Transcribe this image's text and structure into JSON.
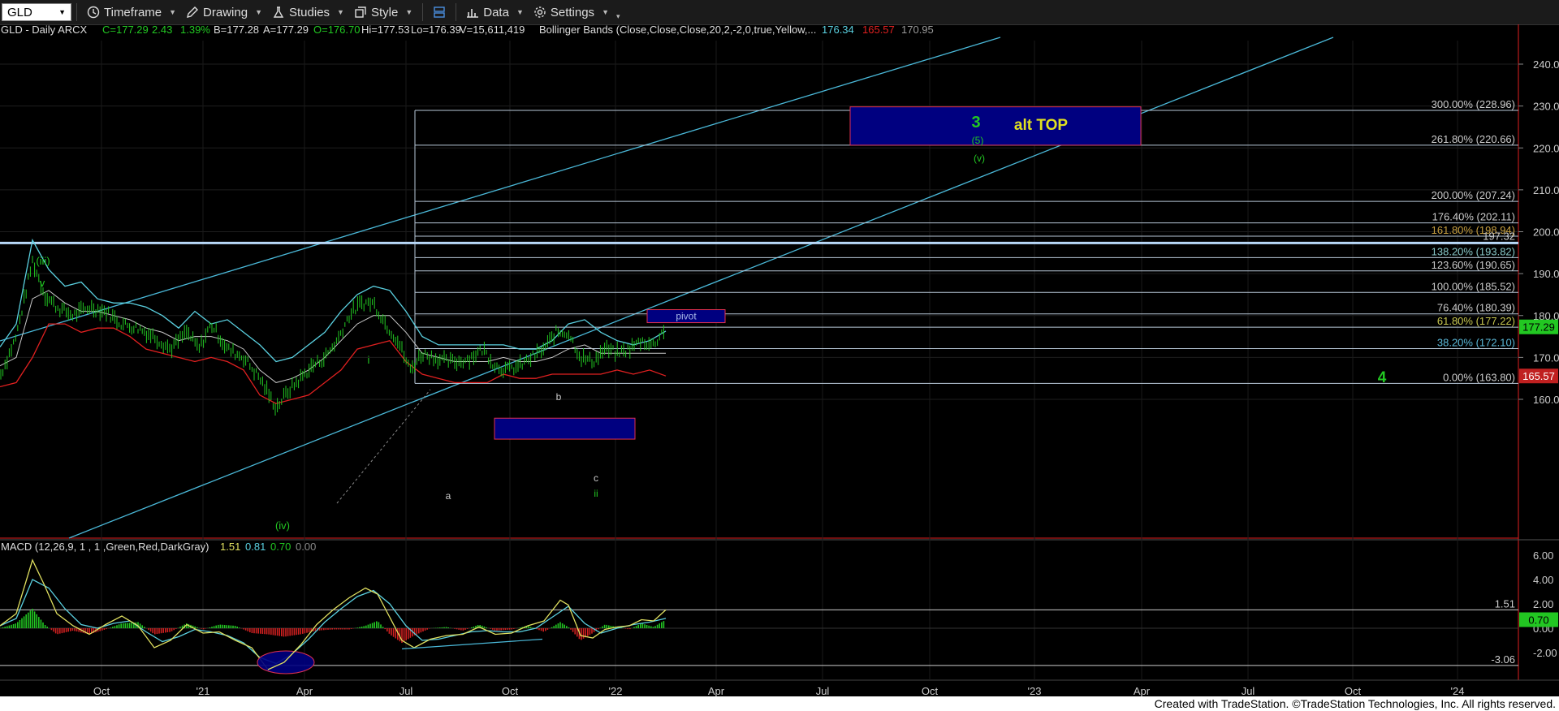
{
  "toolbar": {
    "symbol": "GLD",
    "timeframe": "Timeframe",
    "drawing": "Drawing",
    "studies": "Studies",
    "style": "Style",
    "data": "Data",
    "settings": "Settings"
  },
  "header": {
    "symbol": "GLD - Daily  ARCX",
    "close": "C=177.29",
    "change": "2.43",
    "change_pct": "1.39%",
    "bid": "B=177.28",
    "ask": "A=177.29",
    "open": "O=176.70",
    "high": "Hi=177.53",
    "low": "Lo=176.39",
    "volume": "V=15,611,419",
    "study": "Bollinger Bands (Close,Close,Close,20,2,-2,0,true,Yellow,...",
    "bb_upper": "176.34",
    "bb_lower": "165.57",
    "bb_mid": "170.95"
  },
  "macd_header": {
    "study": "MACD (12,26,9, 1 , 1 ,Green,Red,DarkGray)",
    "macd": "1.51",
    "signal": "0.81",
    "hist": "0.70",
    "zero": "0.00"
  },
  "footer": "Created with TradeStation. ©TradeStation Technologies, Inc. All rights reserved.",
  "colors": {
    "bb_upper": "#5ad0e0",
    "bb_lower": "#e02020",
    "bb_mid": "#c8c8c8",
    "price": "#22c722",
    "fib": "#b8c8d8",
    "channel": "#4ab8d8",
    "box": "#000080",
    "box_border": "#e03050"
  },
  "chart_data": {
    "type": "candlestick-with-indicators",
    "title": "GLD - Daily ARCX",
    "x_tick_labels": [
      "Oct",
      "'21",
      "Apr",
      "Jul",
      "Oct",
      "'22",
      "Apr",
      "Jul",
      "Oct",
      "'23",
      "Apr",
      "Jul",
      "Oct",
      "'24"
    ],
    "price_axis": {
      "range": [
        152,
        248
      ],
      "ticks": [
        160,
        170,
        180,
        190,
        200,
        210,
        220,
        230,
        240
      ]
    },
    "fib_levels": [
      {
        "label": "300.00% (228.96)",
        "value": 228.96
      },
      {
        "label": "261.80% (220.66)",
        "value": 220.66
      },
      {
        "label": "200.00% (207.24)",
        "value": 207.24
      },
      {
        "label": "176.40% (202.11)",
        "value": 202.11
      },
      {
        "label": "161.80% (198.94)",
        "value": 198.94
      },
      {
        "label": "138.20% (193.82)",
        "value": 193.82
      },
      {
        "label": "123.60% (190.65)",
        "value": 190.65
      },
      {
        "label": "100.00% (185.52)",
        "value": 185.52
      },
      {
        "label": "76.40% (180.39)",
        "value": 180.39
      },
      {
        "label": "61.80% (177.22)",
        "value": 177.22
      },
      {
        "label": "38.20% (172.10)",
        "value": 172.1
      },
      {
        "label": "0.00% (163.80)",
        "value": 163.8
      }
    ],
    "horizontal_line": {
      "label": "197.32",
      "value": 197.32
    },
    "price_tags": [
      {
        "label": "177.29",
        "value": 177.29
      },
      {
        "label": "165.57",
        "value": 165.57
      }
    ],
    "annotations": [
      "(iii)",
      "v",
      "(iv)",
      "i",
      "a",
      "b",
      "c",
      "ii",
      "3",
      "alt TOP",
      "(5)",
      "(v)",
      "4",
      "pivot"
    ],
    "macd_axis": {
      "range": [
        -4,
        7.5
      ],
      "ticks": [
        "6.00",
        "4.00",
        "2.00",
        "0.00",
        "-2.00"
      ]
    },
    "macd_levels": [
      {
        "label": "1.51",
        "value": 1.51
      },
      {
        "label": "-3.06",
        "value": -3.06
      }
    ],
    "macd_tag": "0.70",
    "price": [
      [
        0,
        165.5
      ],
      [
        20,
        175
      ],
      [
        40,
        193
      ],
      [
        55,
        185
      ],
      [
        70,
        182
      ],
      [
        90,
        180
      ],
      [
        110,
        182
      ],
      [
        130,
        181
      ],
      [
        150,
        178
      ],
      [
        170,
        177
      ],
      [
        190,
        175
      ],
      [
        210,
        172
      ],
      [
        230,
        176
      ],
      [
        245,
        172
      ],
      [
        260,
        178
      ],
      [
        280,
        172
      ],
      [
        300,
        170
      ],
      [
        320,
        165
      ],
      [
        340,
        158
      ],
      [
        355,
        162
      ],
      [
        370,
        165
      ],
      [
        385,
        168
      ],
      [
        400,
        170
      ],
      [
        415,
        174
      ],
      [
        430,
        180
      ],
      [
        445,
        183
      ],
      [
        460,
        183
      ],
      [
        475,
        178
      ],
      [
        490,
        174
      ],
      [
        505,
        167
      ],
      [
        520,
        171
      ],
      [
        535,
        170
      ],
      [
        550,
        169
      ],
      [
        565,
        169
      ],
      [
        580,
        170
      ],
      [
        595,
        172
      ],
      [
        610,
        168
      ],
      [
        625,
        167
      ],
      [
        640,
        168
      ],
      [
        655,
        170
      ],
      [
        670,
        172
      ],
      [
        685,
        176
      ],
      [
        700,
        176
      ],
      [
        715,
        170
      ],
      [
        730,
        169
      ],
      [
        745,
        172
      ],
      [
        760,
        171
      ],
      [
        775,
        172
      ],
      [
        790,
        174
      ],
      [
        805,
        173
      ],
      [
        815,
        176
      ],
      [
        820,
        177.3
      ]
    ],
    "bb_upper": [
      [
        0,
        172.5
      ],
      [
        20,
        178
      ],
      [
        40,
        198
      ],
      [
        60,
        191
      ],
      [
        80,
        187
      ],
      [
        100,
        188
      ],
      [
        120,
        184
      ],
      [
        140,
        183
      ],
      [
        160,
        183
      ],
      [
        180,
        182
      ],
      [
        200,
        180
      ],
      [
        220,
        177
      ],
      [
        240,
        181
      ],
      [
        260,
        178
      ],
      [
        280,
        179
      ],
      [
        300,
        176
      ],
      [
        320,
        173
      ],
      [
        340,
        169
      ],
      [
        360,
        170
      ],
      [
        380,
        173
      ],
      [
        400,
        176
      ],
      [
        420,
        181
      ],
      [
        440,
        185
      ],
      [
        460,
        187
      ],
      [
        480,
        186
      ],
      [
        500,
        181
      ],
      [
        520,
        175
      ],
      [
        540,
        173
      ],
      [
        560,
        173
      ],
      [
        580,
        173
      ],
      [
        600,
        173
      ],
      [
        620,
        173
      ],
      [
        640,
        172
      ],
      [
        660,
        172
      ],
      [
        680,
        174
      ],
      [
        700,
        178
      ],
      [
        720,
        179
      ],
      [
        740,
        176
      ],
      [
        760,
        174
      ],
      [
        780,
        173
      ],
      [
        800,
        174
      ],
      [
        820,
        176.3
      ]
    ],
    "bb_mid": [
      [
        0,
        168
      ],
      [
        20,
        170
      ],
      [
        40,
        184
      ],
      [
        60,
        186
      ],
      [
        80,
        183
      ],
      [
        100,
        181
      ],
      [
        120,
        181
      ],
      [
        140,
        180
      ],
      [
        160,
        179
      ],
      [
        180,
        177
      ],
      [
        200,
        176
      ],
      [
        220,
        174
      ],
      [
        240,
        175
      ],
      [
        260,
        175
      ],
      [
        280,
        174
      ],
      [
        300,
        172
      ],
      [
        320,
        167
      ],
      [
        340,
        164
      ],
      [
        360,
        165
      ],
      [
        380,
        167
      ],
      [
        400,
        170
      ],
      [
        420,
        174
      ],
      [
        440,
        178
      ],
      [
        460,
        180
      ],
      [
        480,
        180
      ],
      [
        500,
        176
      ],
      [
        520,
        171
      ],
      [
        540,
        170
      ],
      [
        560,
        169
      ],
      [
        580,
        169
      ],
      [
        600,
        169
      ],
      [
        620,
        170
      ],
      [
        640,
        169
      ],
      [
        660,
        169
      ],
      [
        680,
        170
      ],
      [
        700,
        172
      ],
      [
        720,
        173
      ],
      [
        740,
        171
      ],
      [
        760,
        171
      ],
      [
        780,
        171
      ],
      [
        800,
        171
      ],
      [
        820,
        171
      ]
    ],
    "bb_lower": [
      [
        0,
        163
      ],
      [
        20,
        164
      ],
      [
        40,
        170
      ],
      [
        60,
        178
      ],
      [
        80,
        178
      ],
      [
        100,
        176
      ],
      [
        120,
        177
      ],
      [
        140,
        177
      ],
      [
        160,
        175
      ],
      [
        180,
        172
      ],
      [
        200,
        171
      ],
      [
        220,
        170
      ],
      [
        240,
        169
      ],
      [
        260,
        170
      ],
      [
        280,
        169
      ],
      [
        300,
        167
      ],
      [
        320,
        161
      ],
      [
        340,
        159
      ],
      [
        360,
        160
      ],
      [
        380,
        161
      ],
      [
        400,
        164
      ],
      [
        420,
        167
      ],
      [
        440,
        172
      ],
      [
        460,
        173
      ],
      [
        480,
        174
      ],
      [
        500,
        169
      ],
      [
        520,
        166
      ],
      [
        540,
        165
      ],
      [
        560,
        164
      ],
      [
        580,
        164
      ],
      [
        600,
        164
      ],
      [
        620,
        166
      ],
      [
        640,
        165
      ],
      [
        660,
        165
      ],
      [
        680,
        166
      ],
      [
        700,
        166
      ],
      [
        720,
        166
      ],
      [
        740,
        166
      ],
      [
        760,
        167
      ],
      [
        780,
        166
      ],
      [
        800,
        167
      ],
      [
        820,
        165.57
      ]
    ],
    "macd_line": [
      [
        0,
        0.2
      ],
      [
        20,
        1.2
      ],
      [
        40,
        5.6
      ],
      [
        55,
        3.5
      ],
      [
        70,
        1.2
      ],
      [
        90,
        0.2
      ],
      [
        110,
        -0.5
      ],
      [
        130,
        0.3
      ],
      [
        150,
        1.0
      ],
      [
        170,
        0.2
      ],
      [
        190,
        -1.6
      ],
      [
        210,
        -1.0
      ],
      [
        230,
        0.3
      ],
      [
        250,
        -0.4
      ],
      [
        270,
        -0.3
      ],
      [
        290,
        -1.0
      ],
      [
        310,
        -1.6
      ],
      [
        330,
        -3.4
      ],
      [
        350,
        -2.8
      ],
      [
        370,
        -1.4
      ],
      [
        390,
        0.3
      ],
      [
        410,
        1.5
      ],
      [
        430,
        2.5
      ],
      [
        450,
        3.3
      ],
      [
        465,
        2.8
      ],
      [
        480,
        0.9
      ],
      [
        495,
        -1.0
      ],
      [
        510,
        -1.6
      ],
      [
        530,
        -0.9
      ],
      [
        550,
        -0.6
      ],
      [
        570,
        -0.5
      ],
      [
        590,
        0.1
      ],
      [
        610,
        -0.5
      ],
      [
        630,
        -0.4
      ],
      [
        650,
        0.2
      ],
      [
        670,
        0.6
      ],
      [
        690,
        2.3
      ],
      [
        700,
        1.9
      ],
      [
        715,
        -0.6
      ],
      [
        730,
        -0.8
      ],
      [
        745,
        -0.1
      ],
      [
        760,
        0.1
      ],
      [
        775,
        0.2
      ],
      [
        790,
        0.7
      ],
      [
        805,
        0.6
      ],
      [
        820,
        1.51
      ]
    ],
    "macd_signal": [
      [
        0,
        0.2
      ],
      [
        20,
        0.8
      ],
      [
        40,
        4.0
      ],
      [
        60,
        3.3
      ],
      [
        80,
        1.6
      ],
      [
        100,
        0.3
      ],
      [
        120,
        0.0
      ],
      [
        140,
        0.4
      ],
      [
        160,
        0.6
      ],
      [
        180,
        -0.3
      ],
      [
        200,
        -1.1
      ],
      [
        220,
        -0.7
      ],
      [
        240,
        -0.1
      ],
      [
        260,
        -0.3
      ],
      [
        280,
        -0.6
      ],
      [
        300,
        -1.2
      ],
      [
        320,
        -2.4
      ],
      [
        340,
        -2.9
      ],
      [
        360,
        -2.1
      ],
      [
        380,
        -0.9
      ],
      [
        400,
        0.5
      ],
      [
        420,
        1.6
      ],
      [
        440,
        2.6
      ],
      [
        460,
        3.1
      ],
      [
        480,
        2.0
      ],
      [
        500,
        0.2
      ],
      [
        520,
        -1.0
      ],
      [
        540,
        -0.9
      ],
      [
        560,
        -0.6
      ],
      [
        580,
        -0.3
      ],
      [
        600,
        -0.2
      ],
      [
        620,
        -0.3
      ],
      [
        640,
        -0.3
      ],
      [
        660,
        0.0
      ],
      [
        680,
        0.9
      ],
      [
        700,
        1.8
      ],
      [
        720,
        0.4
      ],
      [
        740,
        -0.4
      ],
      [
        760,
        0.0
      ],
      [
        780,
        0.3
      ],
      [
        800,
        0.5
      ],
      [
        820,
        0.81
      ]
    ],
    "macd_hist": [
      [
        0,
        0.0
      ],
      [
        20,
        0.4
      ],
      [
        40,
        1.6
      ],
      [
        55,
        0.3
      ],
      [
        70,
        -0.5
      ],
      [
        90,
        -0.2
      ],
      [
        110,
        -0.5
      ],
      [
        130,
        -0.1
      ],
      [
        150,
        0.4
      ],
      [
        170,
        0.5
      ],
      [
        190,
        -0.5
      ],
      [
        210,
        -0.3
      ],
      [
        230,
        0.4
      ],
      [
        250,
        -0.1
      ],
      [
        270,
        0.3
      ],
      [
        290,
        0.2
      ],
      [
        310,
        -0.4
      ],
      [
        330,
        -0.5
      ],
      [
        350,
        -0.7
      ],
      [
        370,
        -0.5
      ],
      [
        390,
        -0.2
      ],
      [
        410,
        -0.1
      ],
      [
        430,
        -0.1
      ],
      [
        450,
        0.2
      ],
      [
        465,
        0.6
      ],
      [
        480,
        -0.5
      ],
      [
        495,
        -1.2
      ],
      [
        510,
        -0.6
      ],
      [
        530,
        0.0
      ],
      [
        550,
        0.1
      ],
      [
        570,
        -0.2
      ],
      [
        590,
        0.3
      ],
      [
        610,
        -0.2
      ],
      [
        630,
        -0.1
      ],
      [
        650,
        0.2
      ],
      [
        670,
        -0.3
      ],
      [
        690,
        0.5
      ],
      [
        700,
        0.1
      ],
      [
        715,
        -1.0
      ],
      [
        730,
        -0.4
      ],
      [
        745,
        0.3
      ],
      [
        760,
        0.1
      ],
      [
        775,
        -0.1
      ],
      [
        790,
        0.4
      ],
      [
        805,
        0.1
      ],
      [
        820,
        0.7
      ]
    ]
  }
}
